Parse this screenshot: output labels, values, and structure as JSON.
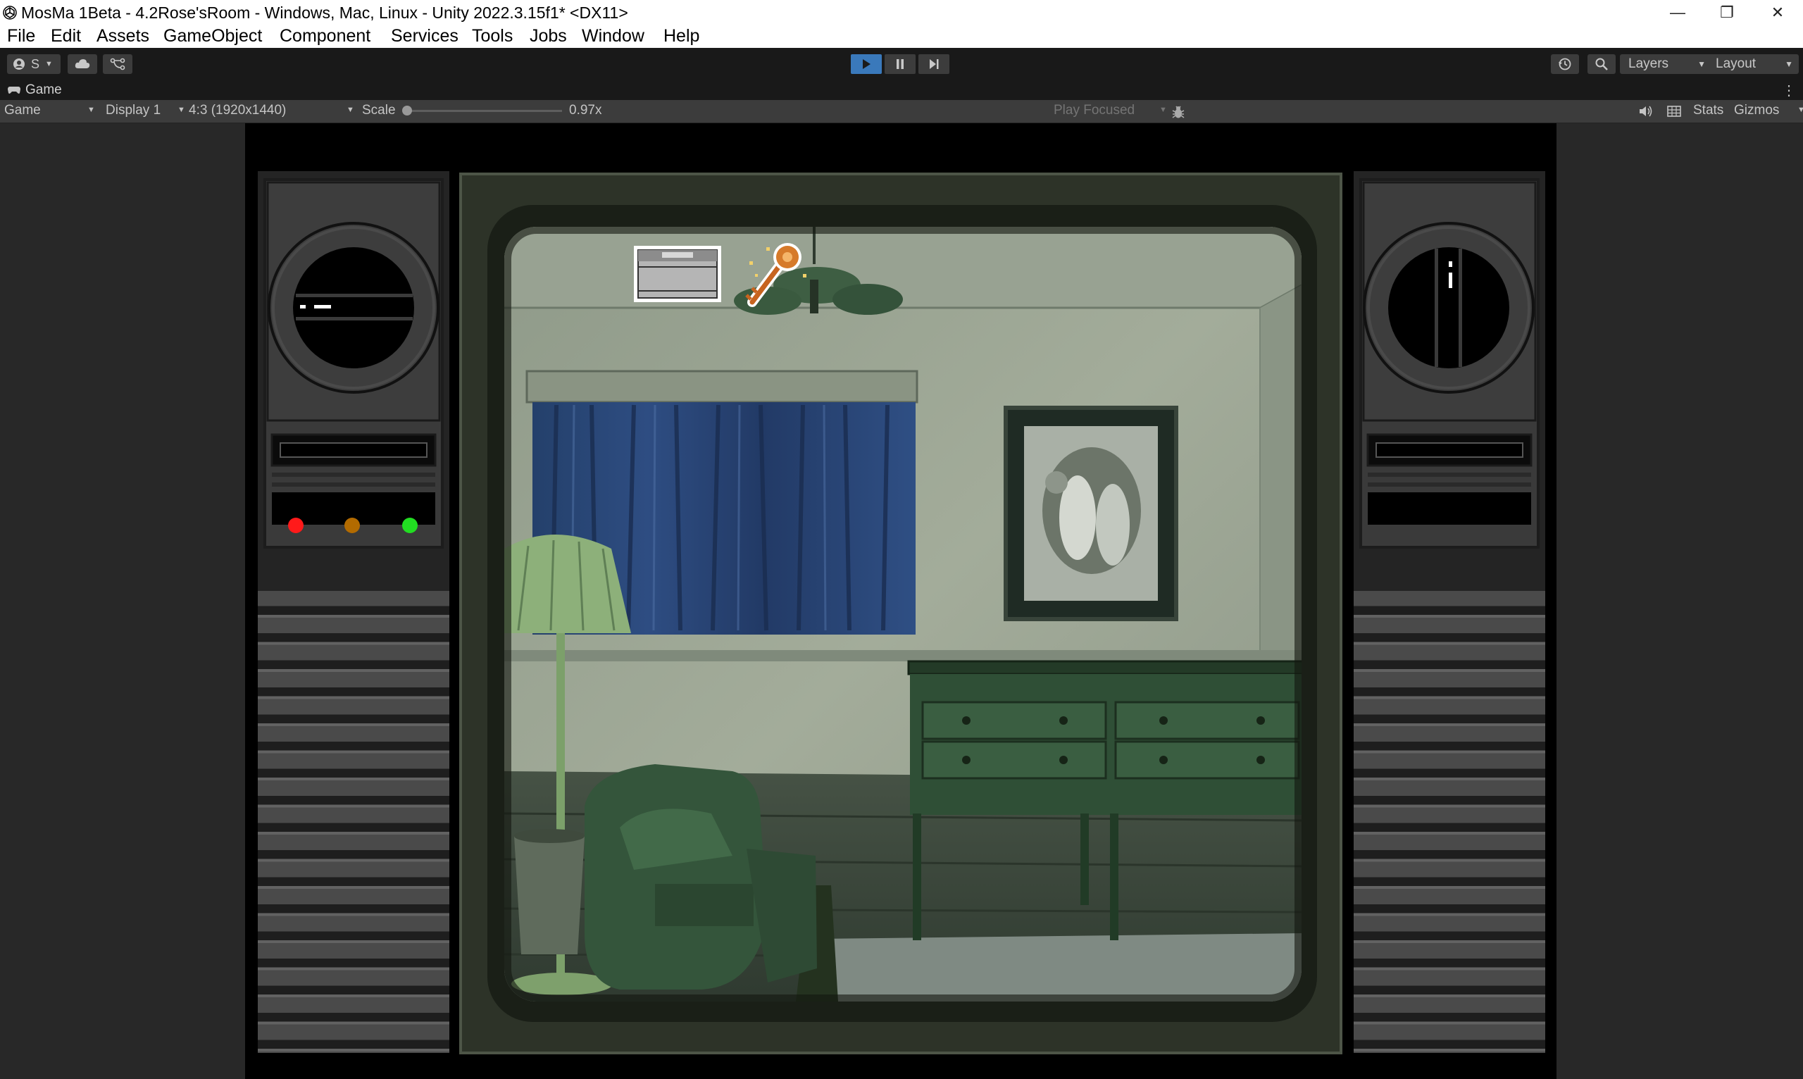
{
  "window": {
    "title": "MosMa 1Beta - 4.2Rose'sRoom - Windows, Mac, Linux - Unity 2022.3.15f1* <DX11>",
    "controls": {
      "minimize": "—",
      "restore": "❐",
      "close": "✕"
    }
  },
  "menu": [
    "File",
    "Edit",
    "Assets",
    "GameObject",
    "Component",
    "Services",
    "Tools",
    "Jobs",
    "Window",
    "Help"
  ],
  "toolbar": {
    "account_label": "S",
    "layers_label": "Layers",
    "layout_label": "Layout",
    "play_state": "playing",
    "accent": "#3a79bb"
  },
  "tab": {
    "label": "Game"
  },
  "gamebar": {
    "view_mode": "Game",
    "display": "Display 1",
    "aspect": "4:3 (1920x1440)",
    "scale_label": "Scale",
    "scale_value": "0.97x",
    "scale_fraction": 0.0,
    "play_focused": "Play Focused",
    "stats": "Stats",
    "gizmos": "Gizmos"
  },
  "game": {
    "left_panel": {
      "indicator_lights": [
        {
          "name": "red-light",
          "color": "#ff1a1a"
        },
        {
          "name": "amber-light",
          "color": "#b36b00"
        },
        {
          "name": "green-light",
          "color": "#22dd22"
        }
      ]
    },
    "scene_colors": {
      "wall": "#9ea896",
      "curtain": "#2e4a7a",
      "floor": "#3f4a40",
      "furniture": "#2f4f36"
    },
    "inventory_items": [
      "box-icon",
      "key-icon"
    ]
  }
}
